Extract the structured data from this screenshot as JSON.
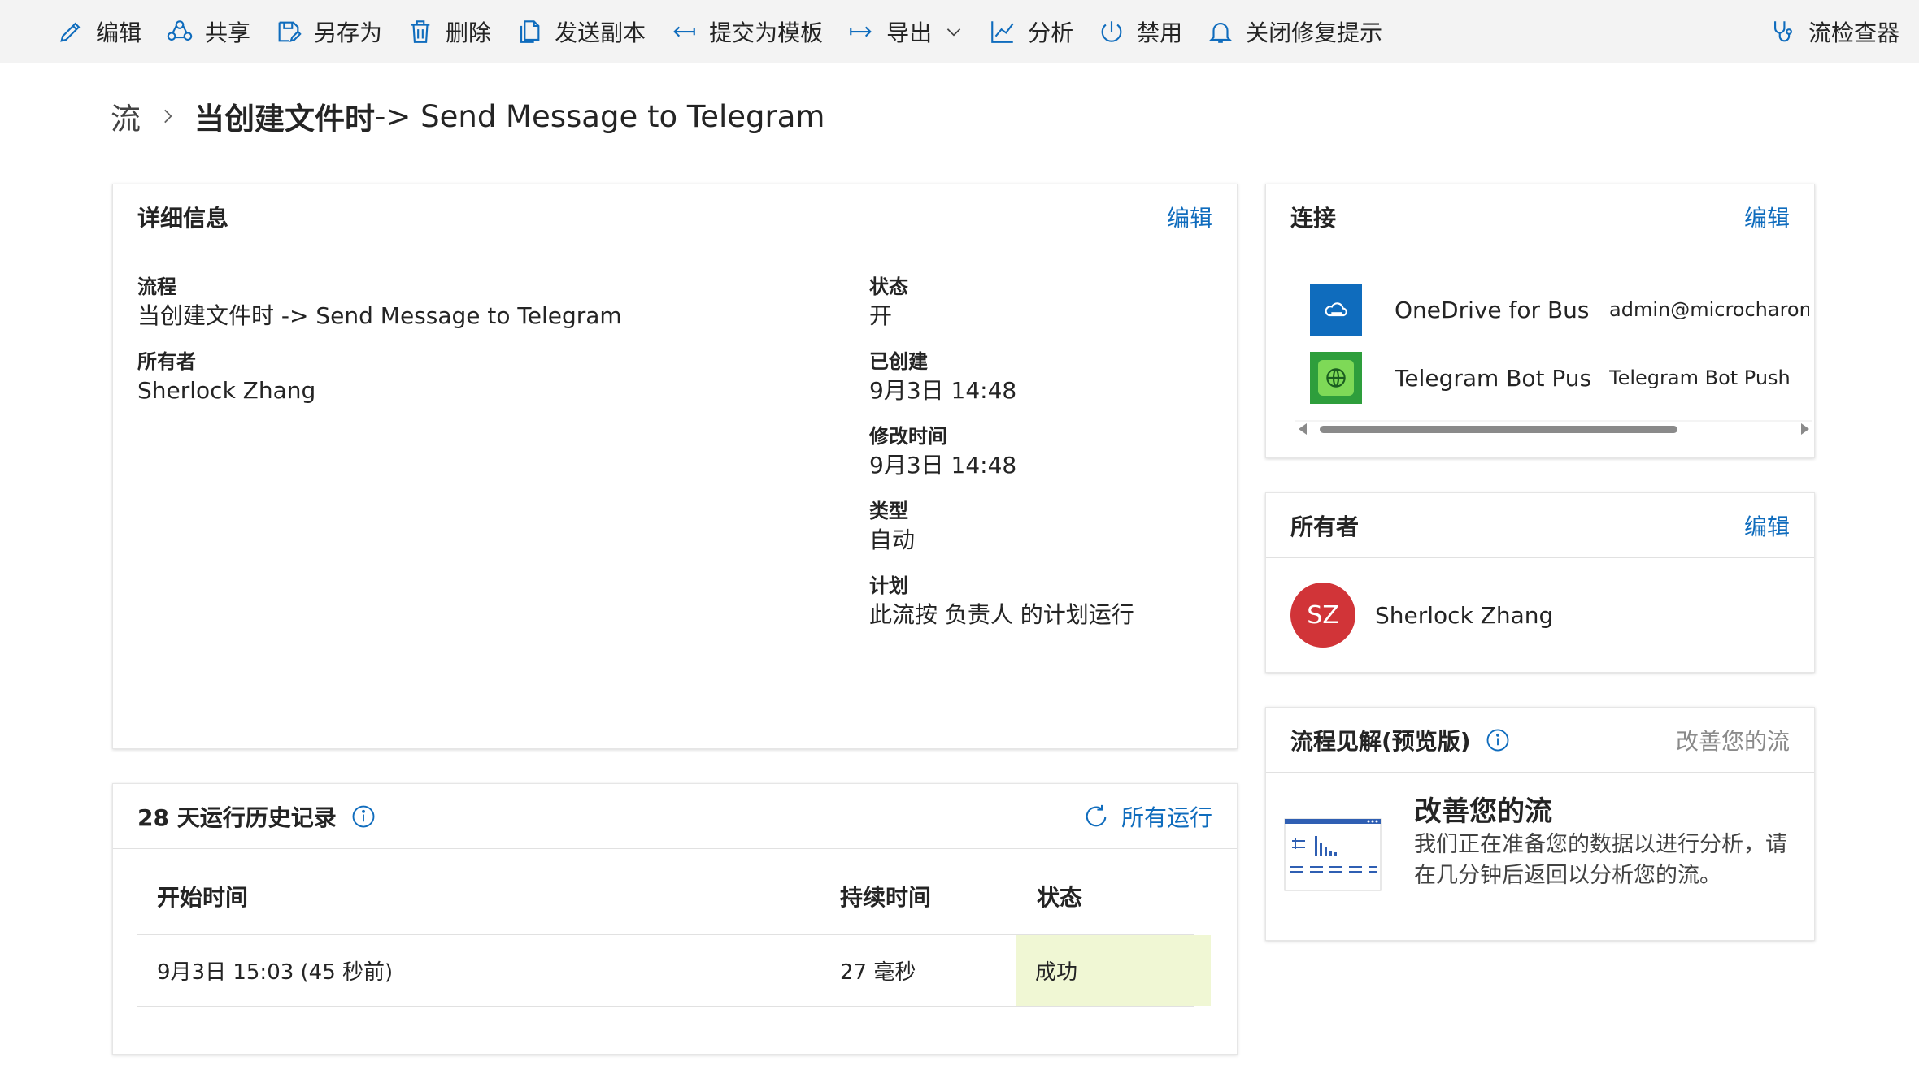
{
  "toolbar": {
    "items": [
      {
        "label": "编辑",
        "icon": "pencil-icon"
      },
      {
        "label": "共享",
        "icon": "share-icon"
      },
      {
        "label": "另存为",
        "icon": "save-as-icon"
      },
      {
        "label": "删除",
        "icon": "trash-icon"
      },
      {
        "label": "发送副本",
        "icon": "copy-icon"
      },
      {
        "label": "提交为模板",
        "icon": "submit-template-icon"
      },
      {
        "label": "导出",
        "icon": "export-icon"
      },
      {
        "label": "分析",
        "icon": "analytics-icon"
      },
      {
        "label": "禁用",
        "icon": "power-icon"
      },
      {
        "label": "关闭修复提示",
        "icon": "bell-icon"
      }
    ],
    "flow_checker": {
      "label": "流检查器",
      "icon": "stethoscope-icon"
    }
  },
  "breadcrumb": {
    "root": "流",
    "title_bold": "当创建文件时",
    "title_rest": " -> Send Message to Telegram"
  },
  "details": {
    "title": "详细信息",
    "edit": "编辑",
    "left": [
      {
        "key": "流程",
        "value": "当创建文件时 -> Send Message to Telegram"
      },
      {
        "key": "所有者",
        "value": "Sherlock Zhang"
      }
    ],
    "right": [
      {
        "key": "状态",
        "value": "开"
      },
      {
        "key": "已创建",
        "value": "9月3日 14:48"
      },
      {
        "key": "修改时间",
        "value": "9月3日 14:48"
      },
      {
        "key": "类型",
        "value": "自动"
      },
      {
        "key": "计划",
        "value": "此流按 负责人 的计划运行"
      }
    ]
  },
  "history": {
    "title": "28 天运行历史记录",
    "all_runs": "所有运行",
    "columns": [
      "开始时间",
      "持续时间",
      "状态"
    ],
    "rows": [
      {
        "start": "9月3日 15:03 (45 秒前)",
        "duration": "27 毫秒",
        "status": "成功"
      }
    ]
  },
  "connections": {
    "title": "连接",
    "edit": "编辑",
    "items": [
      {
        "name": "OneDrive for Business",
        "account": "admin@microcharon.top",
        "icon": "onedrive-icon",
        "color": "#0f6cbd"
      },
      {
        "name": "Telegram Bot Push",
        "account": "Telegram Bot Push",
        "icon": "telegram-globe-icon",
        "color": "#2e9e3c"
      }
    ]
  },
  "owners": {
    "title": "所有者",
    "edit": "编辑",
    "owner": {
      "initials": "SZ",
      "name": "Sherlock Zhang",
      "color": "#d13438"
    }
  },
  "insights": {
    "title": "流程见解(预览版)",
    "link": "改善您的流",
    "heading": "改善您的流",
    "body_line1": "我们正在准备您的数据以进行分析，请",
    "body_line2": "在几分钟后返回以分析您的流。"
  },
  "colors": {
    "accent": "#0f6cbd",
    "success_bg": "#f0f7d4",
    "avatar": "#d13438"
  }
}
